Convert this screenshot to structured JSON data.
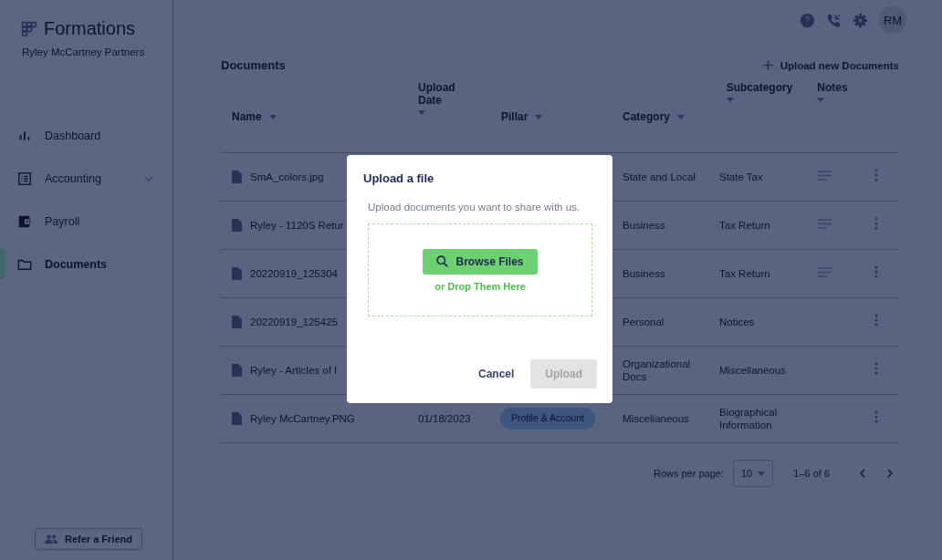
{
  "brand": {
    "name": "Formations",
    "company": "Ryley McCartney Partners"
  },
  "header": {
    "avatar": "RM"
  },
  "sidebar": {
    "items": [
      {
        "label": "Dashboard",
        "selected": false
      },
      {
        "label": "Accounting",
        "selected": false
      },
      {
        "label": "Payroll",
        "selected": false
      },
      {
        "label": "Documents",
        "selected": true
      }
    ],
    "refer_button": "Refer a Friend"
  },
  "documents": {
    "title": "Documents",
    "upload_link": "Upload new Documents",
    "columns": [
      {
        "label": "Name"
      },
      {
        "label": "Upload Date"
      },
      {
        "label": "Pillar"
      },
      {
        "label": "Category"
      },
      {
        "label": "Subcategory"
      },
      {
        "label": "Notes"
      }
    ],
    "rows": [
      {
        "name": "SmA_colors.jpg",
        "category": "State and Local",
        "subcategory": "State Tax",
        "has_notes": true
      },
      {
        "name": "Ryley - 1120S Retur",
        "category": "Business",
        "subcategory": "Tax Return",
        "has_notes": true
      },
      {
        "name": "20220919_125304",
        "category": "Business",
        "subcategory": "Tax Return",
        "has_notes": true
      },
      {
        "name": "20220919_125425",
        "category": "Personal",
        "subcategory": "Notices",
        "has_notes": false
      },
      {
        "name": "Ryley - Articles of I",
        "category": "Organizational Docs",
        "subcategory": "Miscellaneous",
        "has_notes": false
      },
      {
        "name": "Ryley McCartney.PNG",
        "upload_date": "01/18/2023",
        "pillar": "Profile & Account",
        "category": "Miscellaneous",
        "subcategory": "Biographical Information",
        "has_notes": false
      }
    ],
    "pagination": {
      "rows_per_page_label": "Rows per page:",
      "rows_per_page": "10",
      "range": "1–6 of 6"
    }
  },
  "dialog": {
    "title": "Upload a file",
    "description": "Upload documents you want to share with us.",
    "browse_button": "Browse Files",
    "drop_hint": "or Drop Them Here",
    "cancel_button": "Cancel",
    "upload_button": {
      "label": "Upload",
      "disabled": true
    }
  }
}
